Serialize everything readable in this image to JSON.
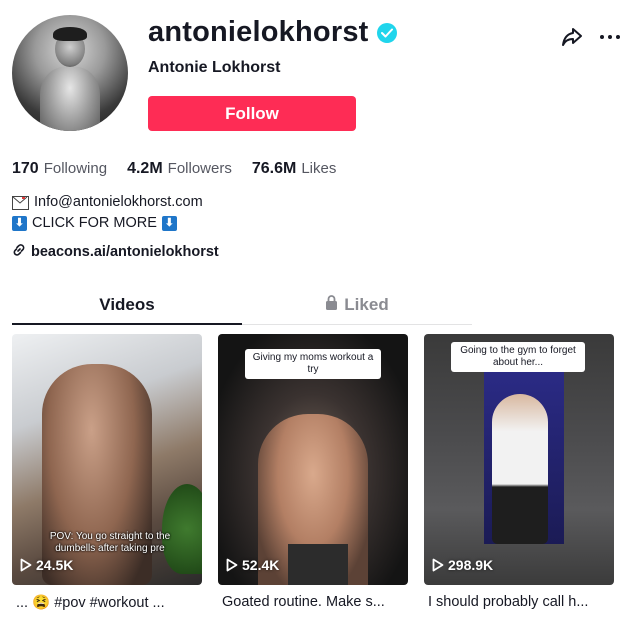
{
  "profile": {
    "username": "antonielokhorst",
    "display_name": "Antonie Lokhorst",
    "follow_label": "Follow"
  },
  "stats": {
    "following_count": "170",
    "following_label": "Following",
    "followers_count": "4.2M",
    "followers_label": "Followers",
    "likes_count": "76.6M",
    "likes_label": "Likes"
  },
  "bio": {
    "email": "Info@antonielokhorst.com",
    "click_more": "CLICK FOR MORE",
    "arrow_emoji": "⬇"
  },
  "link": {
    "text": "beacons.ai/antonielokhorst"
  },
  "tabs": [
    {
      "label": "Videos"
    },
    {
      "label": "Liked"
    }
  ],
  "videos": [
    {
      "overlay_caption": "POV: You go straight to the dumbells after taking pre",
      "views": "24.5K",
      "description": "... 😫 #pov #workout ..."
    },
    {
      "overlay_caption": "Giving my moms workout a try",
      "views": "52.4K",
      "description": "Goated routine. Make s..."
    },
    {
      "overlay_caption": "Going to the gym to forget about her...",
      "views": "298.9K",
      "description": "I should probably call h..."
    }
  ],
  "colors": {
    "follow_button": "#fe2c55",
    "verified_badge": "#20d5ec",
    "text_primary": "#161823",
    "text_secondary": "#8a8b91"
  },
  "icons": [
    "verified-icon",
    "share-icon",
    "more-icon",
    "mail-icon",
    "arrow-down-icon",
    "link-icon",
    "lock-icon",
    "play-icon"
  ]
}
